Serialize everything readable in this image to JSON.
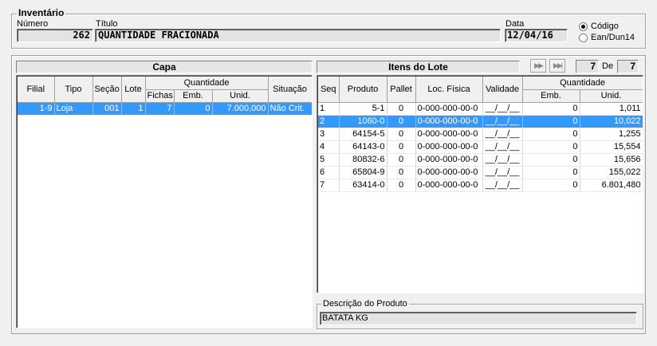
{
  "inventario": {
    "legend": "Inventário",
    "numero_label": "Número",
    "numero_value": "262",
    "titulo_label": "Título",
    "titulo_value": "QUANTIDADE FRACIONADA",
    "data_label": "Data",
    "data_value": "12/04/16",
    "radio_codigo": "Código",
    "radio_ean": "Ean/Dun14",
    "selected_radio": "codigo"
  },
  "capa": {
    "title": "Capa",
    "headers": {
      "filial": "Filial",
      "tipo": "Tipo",
      "secao": "Seção",
      "lote": "Lote",
      "quantidade": "Quantidade",
      "fichas": "Fichas",
      "emb": "Emb.",
      "unid": "Unid.",
      "situacao": "Situação"
    },
    "rows": [
      {
        "filial": "1-9",
        "tipo": "Loja",
        "secao": "001",
        "lote": "1",
        "fichas": "7",
        "emb": "0",
        "unid": "7.000,000",
        "situacao": "Não Crit."
      }
    ]
  },
  "itens": {
    "title": "Itens do Lote",
    "nav_next_icon": "fast-forward",
    "nav_last_icon": "skip-to-end",
    "current_page": "7",
    "de_label": "De",
    "total_pages": "7",
    "headers": {
      "seq": "Seq",
      "produto": "Produto",
      "pallet": "Pallet",
      "loc_fisica": "Loc. Física",
      "validade": "Validade",
      "quantidade": "Quantidade",
      "emb": "Emb.",
      "unid": "Unid."
    },
    "rows": [
      {
        "seq": "1",
        "produto": "5-1",
        "pallet": "0",
        "loc": "0-000-000-00-0",
        "validade": "__/__/__",
        "emb": "0",
        "unid": "1,011"
      },
      {
        "seq": "2",
        "produto": "1060-0",
        "pallet": "0",
        "loc": "0-000-000-00-0",
        "validade": "__/__/__",
        "emb": "0",
        "unid": "10,022"
      },
      {
        "seq": "3",
        "produto": "64154-5",
        "pallet": "0",
        "loc": "0-000-000-00-0",
        "validade": "__/__/__",
        "emb": "0",
        "unid": "1,255"
      },
      {
        "seq": "4",
        "produto": "64143-0",
        "pallet": "0",
        "loc": "0-000-000-00-0",
        "validade": "__/__/__",
        "emb": "0",
        "unid": "15,554"
      },
      {
        "seq": "5",
        "produto": "80832-6",
        "pallet": "0",
        "loc": "0-000-000-00-0",
        "validade": "__/__/__",
        "emb": "0",
        "unid": "15,656"
      },
      {
        "seq": "6",
        "produto": "65804-9",
        "pallet": "0",
        "loc": "0-000-000-00-0",
        "validade": "__/__/__",
        "emb": "0",
        "unid": "155,022"
      },
      {
        "seq": "7",
        "produto": "63414-0",
        "pallet": "0",
        "loc": "0-000-000-00-0",
        "validade": "__/__/__",
        "emb": "0",
        "unid": "6.801,480"
      }
    ],
    "selected_row": 1
  },
  "descricao": {
    "legend": "Descrição do Produto",
    "value": "BATATA KG"
  },
  "colors": {
    "selection": "#3399ff",
    "window_bg": "#f0f0f0",
    "field_bg": "#e3e3e3"
  }
}
